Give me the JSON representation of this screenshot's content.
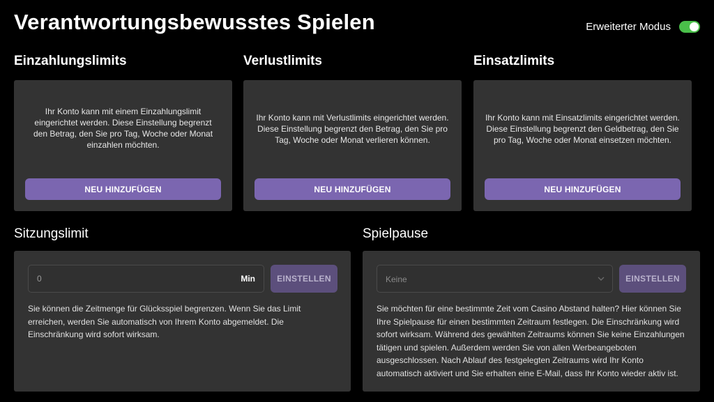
{
  "header": {
    "title": "Verantwortungsbewusstes Spielen",
    "mode_label": "Erweiterter Modus",
    "mode_enabled": true,
    "toggle_color": "#4ac04a"
  },
  "limits": {
    "deposit": {
      "title": "Einzahlungslimits",
      "description": "Ihr Konto kann mit einem Einzahlungslimit eingerichtet werden. Diese Einstellung begrenzt den Betrag, den Sie pro Tag, Woche oder Monat einzahlen möchten.",
      "button_label": "NEU HINZUFÜGEN"
    },
    "loss": {
      "title": "Verlustlimits",
      "description": "Ihr Konto kann mit Verlustlimits eingerichtet werden. Diese Einstellung begrenzt den Betrag, den Sie pro Tag, Woche oder Monat verlieren können.",
      "button_label": "NEU HINZUFÜGEN"
    },
    "wager": {
      "title": "Einsatzlimits",
      "description": "Ihr Konto kann mit Einsatzlimits eingerichtet werden. Diese Einstellung begrenzt den Geldbetrag, den Sie pro Tag, Woche oder Monat einsetzen möchten.",
      "button_label": "NEU HINZUFÜGEN"
    }
  },
  "session": {
    "title": "Sitzungslimit",
    "input_placeholder": "0",
    "input_unit": "Min",
    "button_label": "EINSTELLEN",
    "description": "Sie können die Zeitmenge für Glücksspiel begrenzen. Wenn Sie das Limit erreichen, werden Sie automatisch von Ihrem Konto abgemeldet. Die Einschränkung wird sofort wirksam."
  },
  "pause": {
    "title": "Spielpause",
    "select_value": "Keine",
    "button_label": "EINSTELLEN",
    "description": "Sie möchten für eine bestimmte Zeit vom Casino Abstand halten? Hier können Sie Ihre Spielpause für einen bestimmten Zeitraum festlegen. Die Einschränkung wird sofort wirksam. Während des gewählten Zeitraums können Sie keine Einzahlungen tätigen und spielen. Außerdem werden Sie von allen Werbeangeboten ausgeschlossen. Nach Ablauf des festgelegten Zeitraums wird Ihr Konto automatisch aktiviert und Sie erhalten eine E-Mail, dass Ihr Konto wieder aktiv ist."
  },
  "colors": {
    "background": "#000000",
    "card": "#333333",
    "accent_button": "#7b66b0",
    "muted_button": "#5c4f7c"
  },
  "icons": {
    "select_chevron": "chevron-down-icon"
  }
}
